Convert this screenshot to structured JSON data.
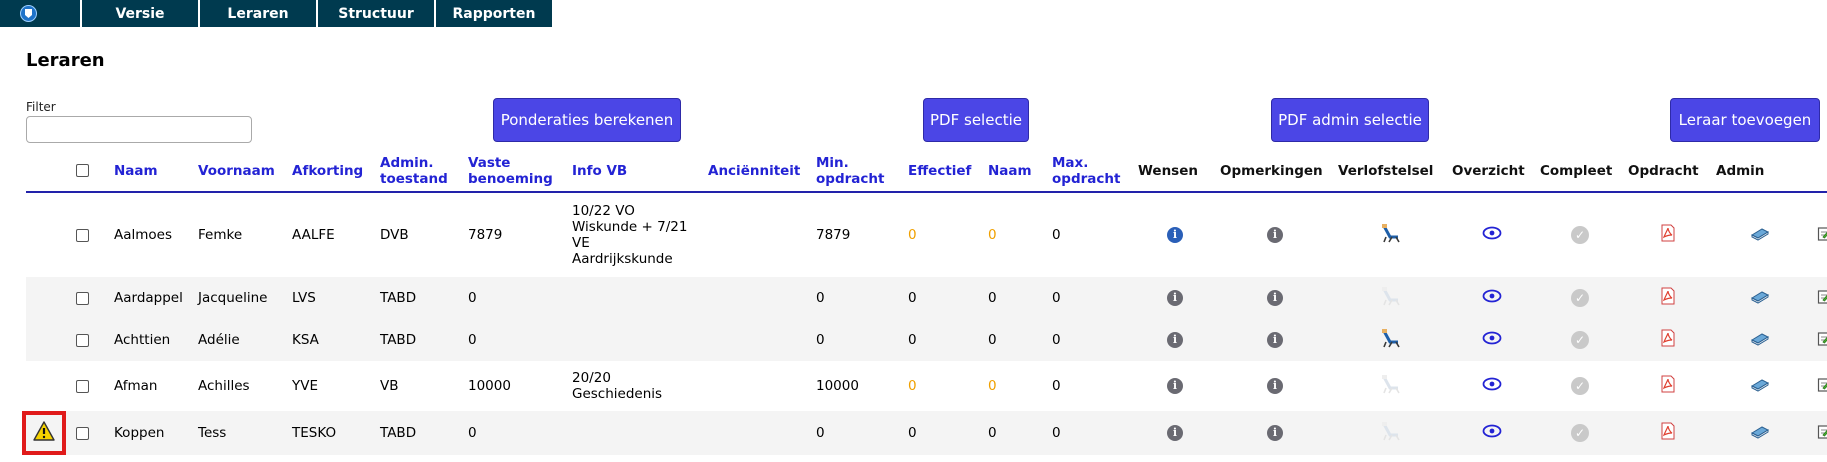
{
  "nav": {
    "items": [
      {
        "label": "Versie"
      },
      {
        "label": "Leraren"
      },
      {
        "label": "Structuur"
      },
      {
        "label": "Rapporten"
      }
    ]
  },
  "page": {
    "title": "Leraren"
  },
  "filter": {
    "label": "Filter",
    "value": ""
  },
  "buttons": {
    "ponderaties": "Ponderaties berekenen",
    "pdf_selectie": "PDF selectie",
    "pdf_admin_selectie": "PDF admin selectie",
    "leraar_toevoegen": "Leraar toevoegen"
  },
  "columns": {
    "naam": "Naam",
    "voornaam": "Voornaam",
    "afkorting": "Afkorting",
    "admin_toestand_1": "Admin.",
    "admin_toestand_2": "toestand",
    "vaste_benoeming_1": "Vaste",
    "vaste_benoeming_2": "benoeming",
    "info_vb": "Info VB",
    "ancienniteit": "Anciënniteit",
    "min_opdracht_1": "Min.",
    "min_opdracht_2": "opdracht",
    "effectief": "Effectief",
    "naam2": "Naam",
    "max_opdracht_1": "Max.",
    "max_opdracht_2": "opdracht",
    "wensen": "Wensen",
    "opmerkingen": "Opmerkingen",
    "verlofstelsel": "Verlofstelsel",
    "overzicht": "Overzicht",
    "compleet": "Compleet",
    "opdracht": "Opdracht",
    "admin": "Admin"
  },
  "rows": [
    {
      "naam": "Aalmoes",
      "voornaam": "Femke",
      "afkorting": "AALFE",
      "admin": "DVB",
      "vaste": "7879",
      "info_vb_1": "10/22 VO",
      "info_vb_2": "Wiskunde + 7/21",
      "info_vb_3": "VE",
      "info_vb_4": "Aardrijkskunde",
      "anc": "",
      "min": "7879",
      "effectief": "0",
      "naam_val": "0",
      "max": "0",
      "wensen_icon": "info-blue-icon",
      "verlof_icon": "beach-chair-icon",
      "verlof_active": true,
      "effectief_highlight": true,
      "warning": false
    },
    {
      "naam": "Aardappel",
      "voornaam": "Jacqueline",
      "afkorting": "LVS",
      "admin": "TABD",
      "vaste": "0",
      "info_vb_1": "",
      "info_vb_2": "",
      "info_vb_3": "",
      "info_vb_4": "",
      "anc": "",
      "min": "0",
      "effectief": "0",
      "naam_val": "0",
      "max": "0",
      "wensen_icon": "info-icon",
      "verlof_icon": "beach-chair-icon",
      "verlof_active": false,
      "effectief_highlight": false,
      "warning": false
    },
    {
      "naam": "Achttien",
      "voornaam": "Adélie",
      "afkorting": "KSA",
      "admin": "TABD",
      "vaste": "0",
      "info_vb_1": "",
      "info_vb_2": "",
      "info_vb_3": "",
      "info_vb_4": "",
      "anc": "",
      "min": "0",
      "effectief": "0",
      "naam_val": "0",
      "max": "0",
      "wensen_icon": "info-icon",
      "verlof_icon": "beach-chair-icon",
      "verlof_active": true,
      "effectief_highlight": false,
      "warning": false
    },
    {
      "naam": "Afman",
      "voornaam": "Achilles",
      "afkorting": "YVE",
      "admin": "VB",
      "vaste": "10000",
      "info_vb_1": "20/20",
      "info_vb_2": "Geschiedenis",
      "info_vb_3": "",
      "info_vb_4": "",
      "anc": "",
      "min": "10000",
      "effectief": "0",
      "naam_val": "0",
      "max": "0",
      "wensen_icon": "info-icon",
      "verlof_icon": "beach-chair-icon",
      "verlof_active": false,
      "effectief_highlight": true,
      "warning": false
    },
    {
      "naam": "Koppen",
      "voornaam": "Tess",
      "afkorting": "TESKO",
      "admin": "TABD",
      "vaste": "0",
      "info_vb_1": "",
      "info_vb_2": "",
      "info_vb_3": "",
      "info_vb_4": "",
      "anc": "",
      "min": "0",
      "effectief": "0",
      "naam_val": "0",
      "max": "0",
      "wensen_icon": "info-icon",
      "verlof_icon": "beach-chair-icon",
      "verlof_active": false,
      "effectief_highlight": false,
      "warning": true
    }
  ],
  "colors": {
    "nav_bg": "#003a4f",
    "button_bg": "#4b46e6",
    "header_blue": "#2323d4",
    "orange_value": "#f0a000",
    "warning_border": "#e01a1a"
  }
}
